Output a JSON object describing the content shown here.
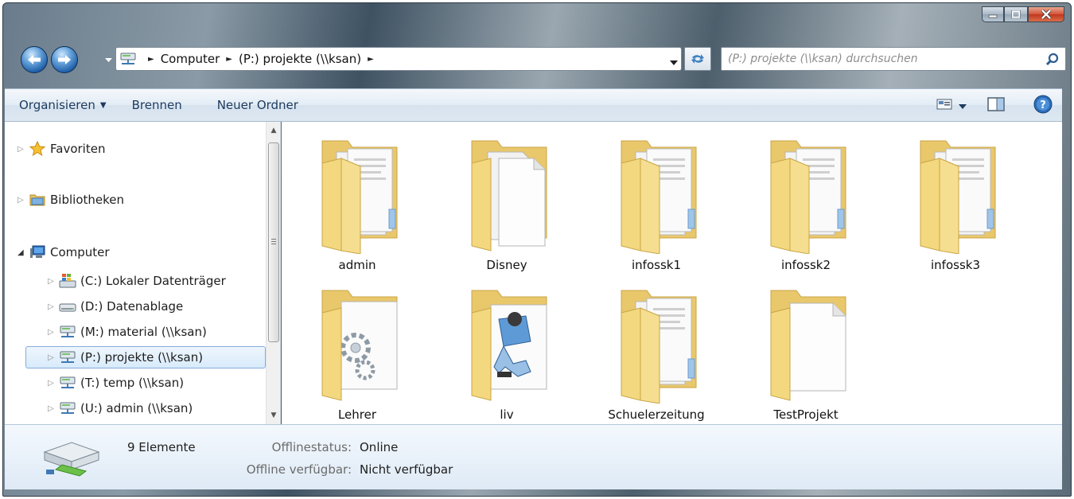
{
  "window": {
    "controls": {
      "minimize_icon": "minimize-icon",
      "maximize_icon": "maximize-icon",
      "close_icon": "close-icon"
    }
  },
  "address": {
    "breadcrumbs": [
      "Computer",
      "(P:) projekte (\\\\ksan)"
    ],
    "search_placeholder": "(P:) projekte (\\\\ksan) durchsuchen"
  },
  "toolbar": {
    "organize_label": "Organisieren",
    "burn_label": "Brennen",
    "new_folder_label": "Neuer Ordner"
  },
  "nav": {
    "favorites": "Favoriten",
    "libraries": "Bibliotheken",
    "computer": "Computer",
    "drives": [
      {
        "label": "(C:) Lokaler Datenträger",
        "icon": "windows-drive-icon"
      },
      {
        "label": "(D:) Datenablage",
        "icon": "hard-drive-icon"
      },
      {
        "label": "(M:) material (\\\\ksan)",
        "icon": "network-drive-icon"
      },
      {
        "label": "(P:) projekte (\\\\ksan)",
        "icon": "network-drive-icon",
        "selected": true
      },
      {
        "label": "(T:) temp (\\\\ksan)",
        "icon": "network-drive-icon"
      },
      {
        "label": "(U:) admin (\\\\ksan)",
        "icon": "network-drive-icon"
      }
    ]
  },
  "folders": [
    {
      "name": "admin",
      "style": "docs"
    },
    {
      "name": "Disney",
      "style": "pages"
    },
    {
      "name": "infossk1",
      "style": "docs"
    },
    {
      "name": "infossk2",
      "style": "docs"
    },
    {
      "name": "infossk3",
      "style": "docs"
    },
    {
      "name": "Lehrer",
      "style": "gear"
    },
    {
      "name": "liv",
      "style": "picture"
    },
    {
      "name": "Schuelerzeitung",
      "style": "docs"
    },
    {
      "name": "TestProjekt",
      "style": "blank"
    }
  ],
  "details": {
    "count": "9 Elemente",
    "offline_status_label": "Offlinestatus:",
    "offline_status_value": "Online",
    "offline_available_label": "Offline verfügbar:",
    "offline_available_value": "Nicht verfügbar"
  },
  "colors": {
    "folder": "#f2d680",
    "folder_dark": "#d8b54e",
    "selection": "#d8ebfb",
    "toolbar_text": "#1c3a5e"
  }
}
